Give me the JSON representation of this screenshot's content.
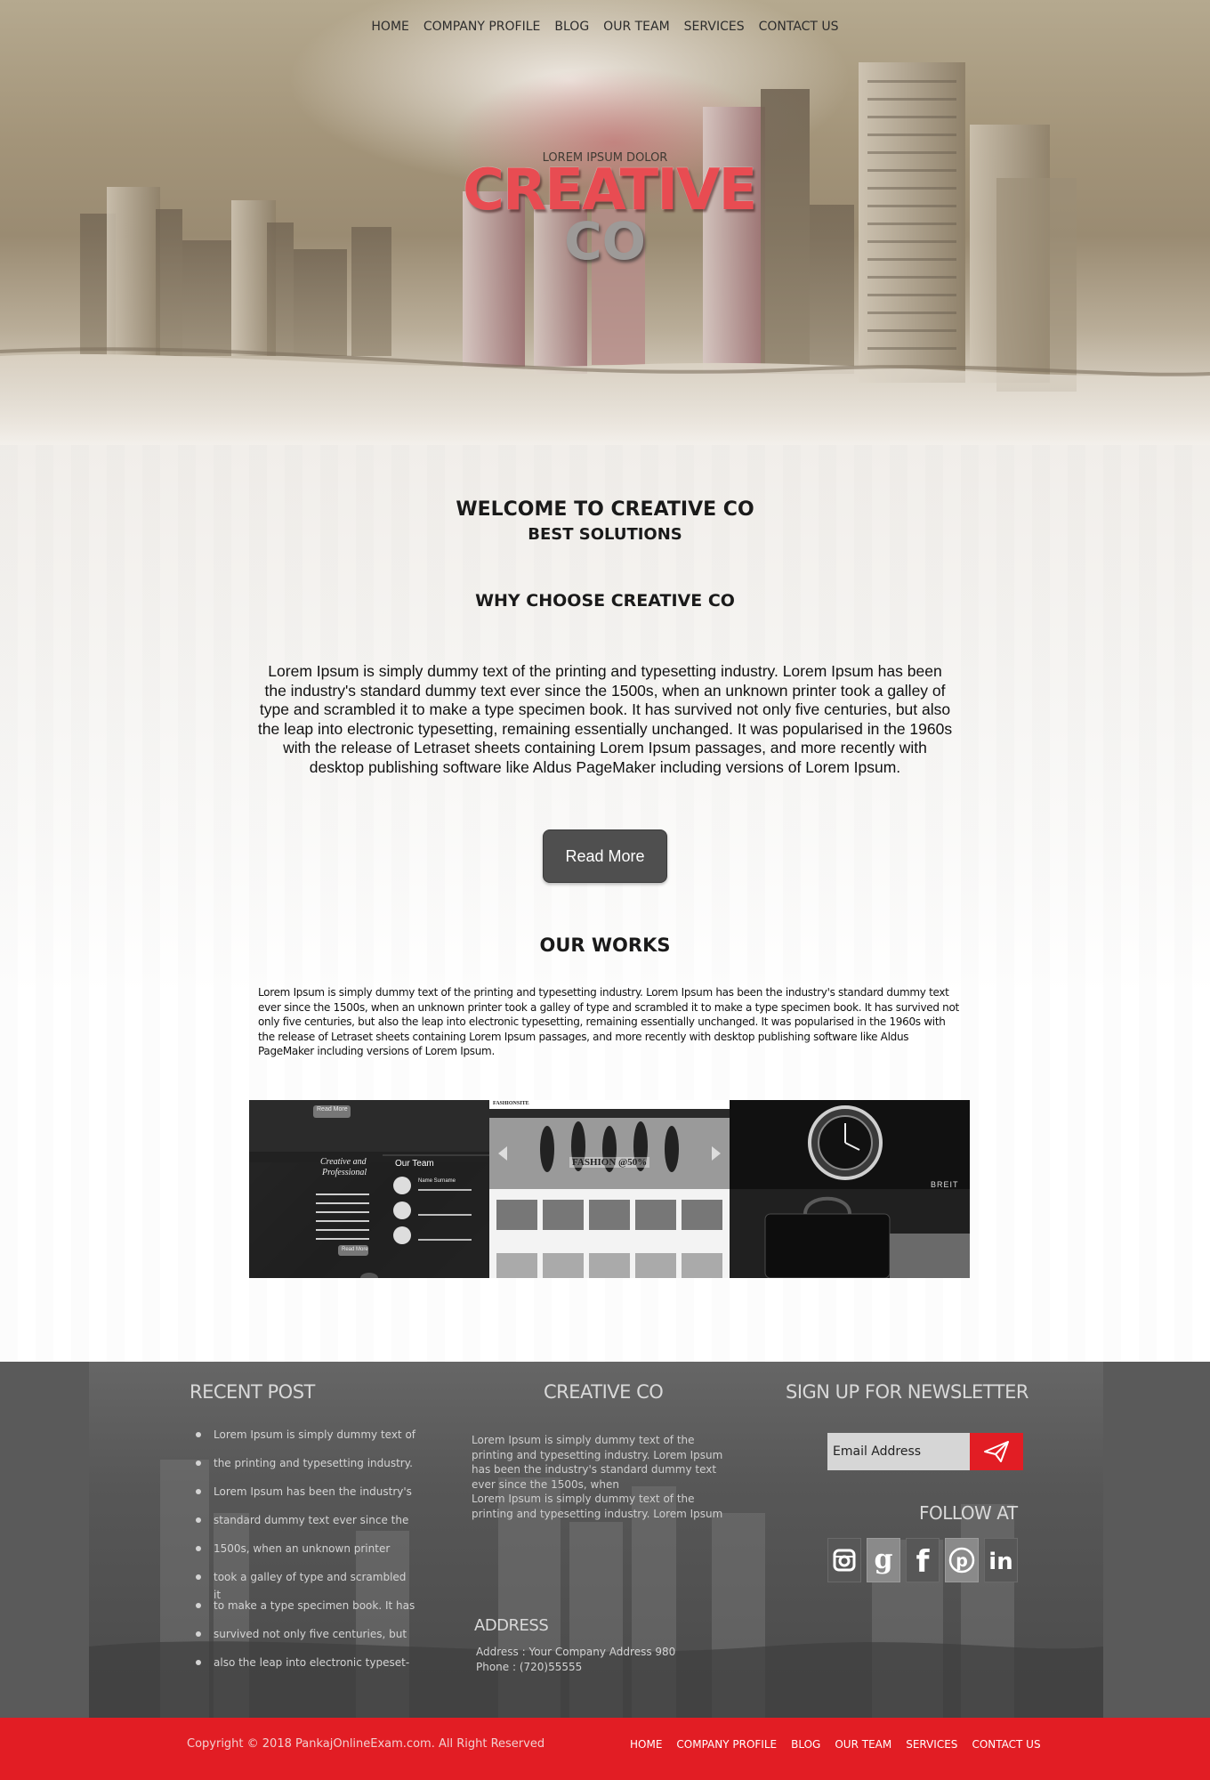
{
  "nav": {
    "items": [
      "HOME",
      "COMPANY PROFILE",
      "BLOG",
      "OUR TEAM",
      "SERVICES",
      "CONTACT US"
    ]
  },
  "hero": {
    "tagline": "LOREM IPSUM DOLOR",
    "logo_main": "CREATIVE",
    "logo_sub": "CO"
  },
  "welcome": {
    "title": "WELCOME TO CREATIVE CO",
    "subtitle": "BEST SOLUTIONS"
  },
  "why": {
    "title": "WHY CHOOSE CREATIVE CO",
    "text": "Lorem Ipsum is simply dummy text of the printing and typesetting industry. Lorem Ipsum has been the industry's standard dummy text ever since the 1500s, when an unknown printer took a galley of type and scrambled it to make a type specimen book. It has survived not only five centuries, but also the leap into electronic typesetting, remaining essentially unchanged. It was popularised in the 1960s with the release of Letraset sheets containing Lorem Ipsum passages, and more recently with desktop publishing software like Aldus PageMaker including versions of Lorem Ipsum.",
    "button_label": "Read More"
  },
  "works": {
    "title": "OUR WORKS",
    "text": "Lorem Ipsum is simply dummy text of the printing and typesetting industry. Lorem Ipsum has been the industry's standard dummy text ever since the 1500s, when an unknown printer took a galley of type and scrambled it to make a type specimen book. It has survived not only five centuries, but also the leap into electronic typesetting, remaining essentially unchanged. It was popularised in the 1960s with the release of Letraset sheets containing Lorem Ipsum passages, and more recently with desktop publishing software like Aldus PageMaker including versions of Lorem Ipsum.",
    "thumb1": {
      "button": "Read More",
      "heading_line1": "Creative and",
      "heading_line2": "Professional",
      "team_title": "Our Team",
      "member_name": "Name Surname",
      "read_more": "Read More"
    },
    "thumb2": {
      "brand": "FASHIONSITE",
      "banner": "FASHION @50%"
    },
    "thumb3": {
      "brand": "BREIT"
    }
  },
  "footer": {
    "recent_title": "RECENT POST",
    "recent_items": [
      "Lorem Ipsum is simply dummy text of",
      "the printing and typesetting industry.",
      "Lorem Ipsum has been the industry's",
      "standard dummy text ever since the",
      "1500s, when an unknown printer",
      "took a galley of type and scrambled it",
      "to make a type specimen book. It has",
      "survived not only five centuries, but",
      "also the leap into electronic typeset-"
    ],
    "about_title": "CREATIVE CO",
    "about_text_1": "Lorem Ipsum is simply dummy text of the printing and typesetting industry. Lorem Ipsum has been the industry's standard dummy text ever since the 1500s, when",
    "about_text_2": "Lorem Ipsum is simply dummy text of the printing and typesetting industry. Lorem Ipsum",
    "address_title": "ADDRESS",
    "address_line": "Address : Your Company Address 980",
    "phone_line": "Phone : (720)55555",
    "newsletter_title": "SIGN UP FOR NEWSLETTER",
    "email_placeholder": "Email Address",
    "follow_title": "FOLLOW AT",
    "social_icons": [
      "instagram-icon",
      "google-icon",
      "facebook-icon",
      "pinterest-icon",
      "linkedin-icon"
    ]
  },
  "bottom": {
    "copyright": "Copyright © 2018 PankajOnlineExam.com. All Right Reserved",
    "nav": [
      "HOME",
      "COMPANY PROFILE",
      "BLOG",
      "OUR TEAM",
      "SERVICES",
      "CONTACT US"
    ]
  },
  "colors": {
    "accent_red": "#e21d24",
    "logo_red": "#e84c52",
    "button_gray": "#4f4f4f",
    "footer_gray": "#5a5a5a"
  }
}
